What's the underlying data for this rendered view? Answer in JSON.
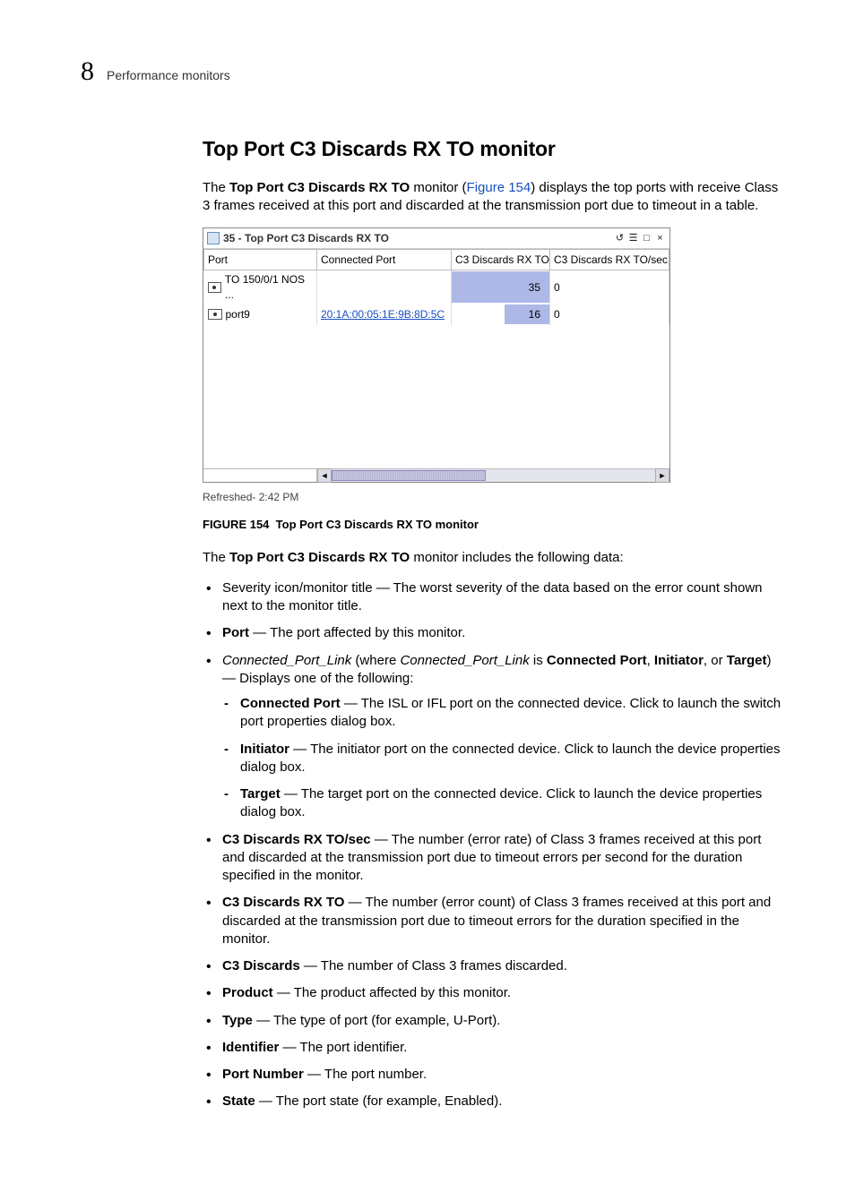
{
  "header": {
    "chapter_number": "8",
    "chapter_title": "Performance monitors"
  },
  "section": {
    "title": "Top Port C3 Discards RX TO monitor",
    "intro_pre": "The ",
    "intro_bold": "Top Port C3 Discards RX TO",
    "intro_mid": " monitor (",
    "intro_link": "Figure 154",
    "intro_post": ") displays the top ports with receive Class 3 frames received at this port and discarded at the transmission port due to timeout in a table."
  },
  "panel": {
    "title": "35 - Top Port C3 Discards RX TO",
    "columns": [
      "Port",
      "Connected Port",
      "C3 Discards RX TO",
      "C3 Discards RX TO/sec"
    ],
    "rows": [
      {
        "port": "TO 150/0/1 NOS ...",
        "connected": "",
        "bar_value": "35",
        "bar_pct": 100,
        "rate": "0"
      },
      {
        "port": "port9",
        "connected": "20:1A:00:05:1E:9B:8D:5C",
        "bar_value": "16",
        "bar_pct": 46,
        "rate": "0"
      }
    ],
    "refreshed": "Refreshed- 2:42 PM"
  },
  "figure": {
    "label": "FIGURE 154",
    "caption": "Top Port C3 Discards RX TO monitor"
  },
  "includes_line": {
    "pre": "The ",
    "bold": "Top Port C3 Discards RX TO",
    "post": " monitor includes the following data:"
  },
  "bullets": {
    "severity": "Severity icon/monitor title — The worst severity of the data based on the error count shown next to the monitor title.",
    "port_label": "Port",
    "port_desc": " — The port affected by this monitor.",
    "cpl_italic1": "Connected_Port_Link",
    "cpl_mid1": " (where ",
    "cpl_italic2": "Connected_Port_Link",
    "cpl_mid2": " is ",
    "cpl_bold1": "Connected Port",
    "cpl_sep1": ", ",
    "cpl_bold2": "Initiator",
    "cpl_sep2": ", or ",
    "cpl_bold3": "Target",
    "cpl_mid3": ") — Displays one of the following:",
    "sub_connected_label": "Connected Port",
    "sub_connected_desc": " — The ISL or IFL port on the connected device. Click to launch the switch port properties dialog box.",
    "sub_initiator_label": "Initiator",
    "sub_initiator_desc": " — The initiator port on the connected device. Click to launch the device properties dialog box.",
    "sub_target_label": "Target",
    "sub_target_desc": " — The target port on the connected device. Click to launch the device properties dialog box.",
    "c3sec_label": "C3 Discards RX TO/sec",
    "c3sec_desc": " — The number (error rate) of Class 3 frames received at this port and discarded at the transmission port due to timeout errors per second for the duration specified in the monitor.",
    "c3to_label": "C3 Discards RX TO",
    "c3to_desc": " — The number (error count) of Class 3 frames received at this port and discarded at the transmission port due to timeout errors for the duration specified in the monitor.",
    "c3d_label": "C3 Discards",
    "c3d_desc": " — The number of Class 3 frames discarded.",
    "product_label": "Product",
    "product_desc": " — The product affected by this monitor.",
    "type_label": "Type",
    "type_desc": " — The type of port (for example, U-Port).",
    "identifier_label": "Identifier",
    "identifier_desc": " — The port identifier.",
    "portnum_label": "Port Number",
    "portnum_desc": " — The port number.",
    "state_label": "State",
    "state_desc": " — The port state (for example, Enabled)."
  }
}
